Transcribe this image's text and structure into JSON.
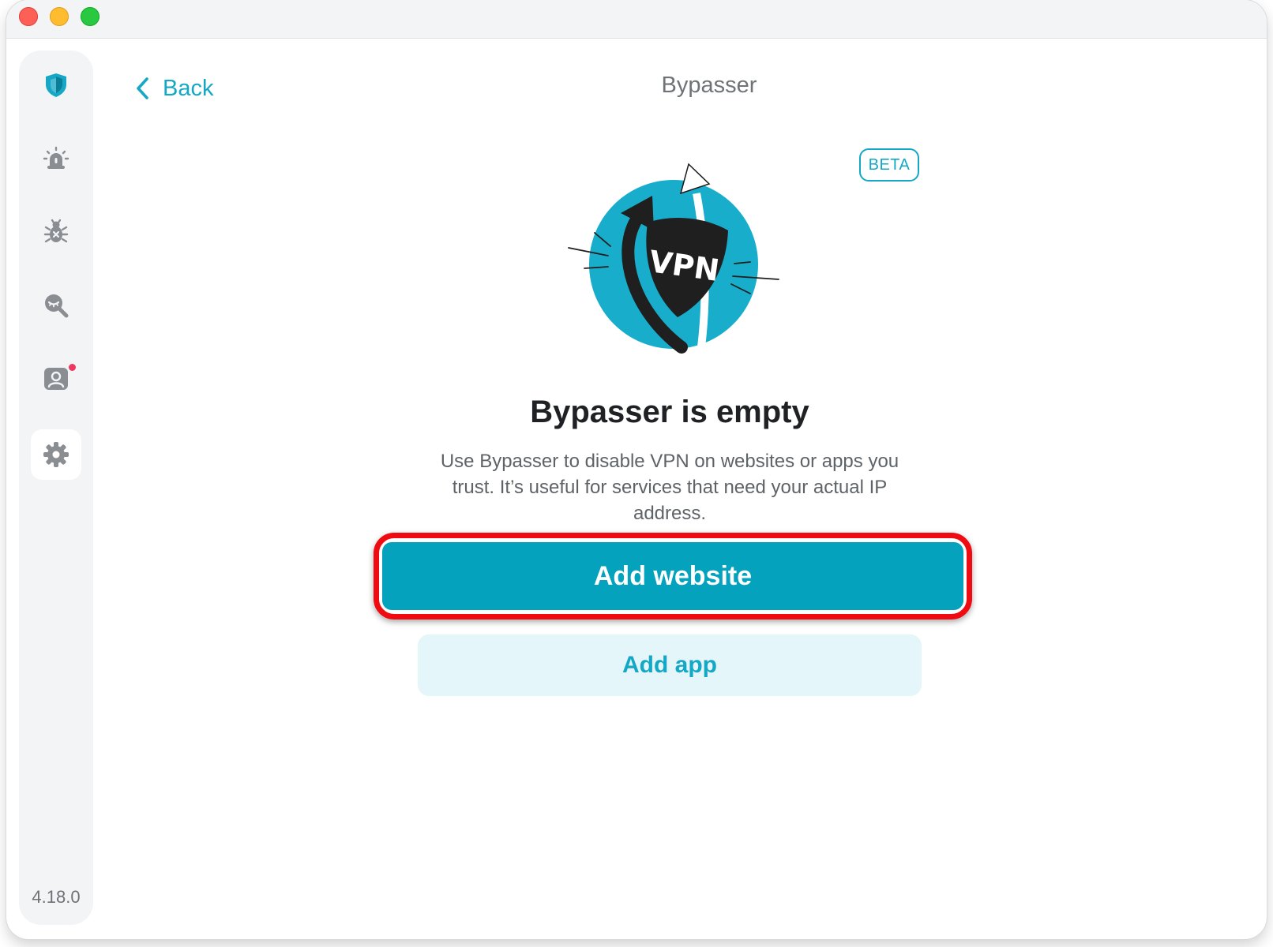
{
  "window": {
    "controls": [
      "close",
      "minimize",
      "zoom"
    ]
  },
  "sidebar": {
    "items": [
      {
        "id": "protection",
        "icon": "shield-icon",
        "active": false
      },
      {
        "id": "alerts",
        "icon": "alarm-siren-icon",
        "active": false
      },
      {
        "id": "antivirus",
        "icon": "bug-icon",
        "active": false
      },
      {
        "id": "dark-web-monitor",
        "icon": "magnifier-eye-icon",
        "active": false
      },
      {
        "id": "account",
        "icon": "account-icon",
        "active": false,
        "has_notification": true
      },
      {
        "id": "settings",
        "icon": "gear-icon",
        "active": true
      }
    ],
    "version": "4.18.0"
  },
  "header": {
    "back_label": "Back",
    "title": "Bypasser"
  },
  "badge": "BETA",
  "illustration": {
    "icon": "vpn-bypass-illustration",
    "text": "VPN"
  },
  "empty_state": {
    "heading": "Bypasser is empty",
    "description": "Use Bypasser to disable VPN on websites or apps you trust. It’s useful for services that need your actual IP address."
  },
  "actions": {
    "add_website": "Add website",
    "add_app": "Add app"
  },
  "colors": {
    "accent": "#15a8c6",
    "primary_button": "#04a2bd",
    "secondary_button_bg": "#e5f6fa",
    "highlight": "#ee0b12",
    "notification": "#f0385e"
  }
}
